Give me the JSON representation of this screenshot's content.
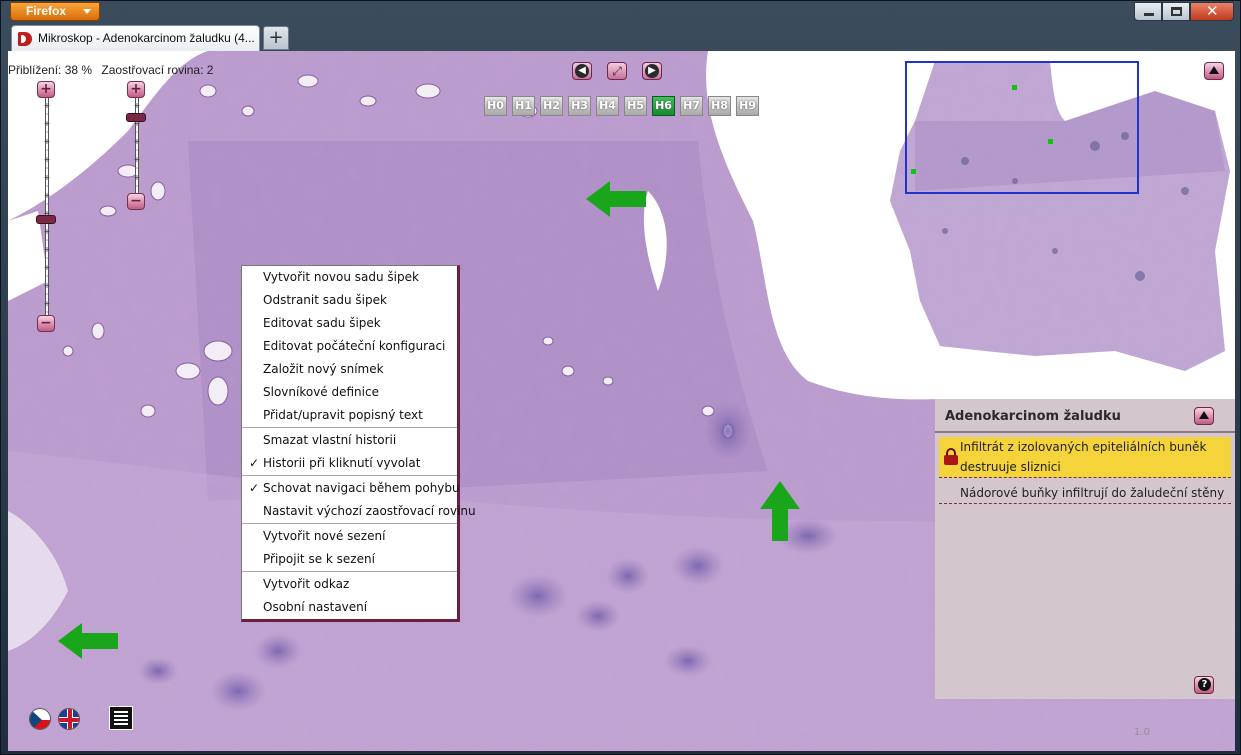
{
  "browser": {
    "app_button": "Firefox",
    "tab_title": "Mikroskop - Adenokarcinom žaludku (4...",
    "new_tab": "+"
  },
  "status": {
    "zoom": "Přiblížení: 38 %",
    "focus_plane": "Zaostřovací rovina: 2"
  },
  "zoom_slider": {
    "plus": "+",
    "minus": "−",
    "level": 0.55
  },
  "focus_slider": {
    "plus": "+",
    "minus": "−",
    "level": 0.15
  },
  "layers": {
    "items": [
      "H0",
      "H1",
      "H2",
      "H3",
      "H4",
      "H5",
      "H6",
      "H7",
      "H8",
      "H9"
    ],
    "active": "H6"
  },
  "context_menu": {
    "groups": [
      [
        {
          "label": "Vytvořit novou sadu šipek",
          "checked": false
        },
        {
          "label": "Odstranit sadu šipek",
          "checked": false
        },
        {
          "label": "Editovat sadu šipek",
          "checked": false
        },
        {
          "label": "Editovat počáteční konfiguraci",
          "checked": false
        },
        {
          "label": "Založit nový snímek",
          "checked": false
        },
        {
          "label": "Slovníkové definice",
          "checked": false
        },
        {
          "label": "Přidat/upravit popisný text",
          "checked": false
        }
      ],
      [
        {
          "label": "Smazat vlastní historii",
          "checked": false
        },
        {
          "label": "Historii při kliknutí vyvolat",
          "checked": true
        }
      ],
      [
        {
          "label": "Schovat navigaci během pohybu",
          "checked": true
        },
        {
          "label": "Nastavit výchozí zaostřovací rovinu",
          "checked": false
        }
      ],
      [
        {
          "label": "Vytvořit nové sezení",
          "checked": false
        },
        {
          "label": "Připojit se k sezení",
          "checked": false
        }
      ],
      [
        {
          "label": "Vytvořit odkaz",
          "checked": false
        },
        {
          "label": "Osobní nastavení",
          "checked": false
        }
      ]
    ],
    "check_glyph": "✓"
  },
  "panel": {
    "title": "Adenokarcinom žaludku",
    "entries": [
      {
        "text": "Infiltrát z izolovaných epiteliálních buněk destruuje sliznici",
        "selected": true,
        "locked": true
      },
      {
        "text": "Nádorové buňky infiltrují do žaludeční stěny",
        "selected": false,
        "locked": false
      }
    ],
    "help": "?"
  },
  "version": "1.0",
  "colors": {
    "accent": "#c05b87",
    "active_layer": "#148a2d",
    "minimap_frame": "#2233cc",
    "selected_entry": "#f4d33b",
    "arrow": "#1aa61a"
  }
}
